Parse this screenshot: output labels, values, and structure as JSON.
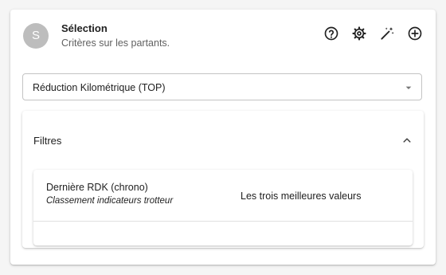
{
  "card": {
    "avatar_letter": "S",
    "title": "Sélection",
    "subtitle": "Critères sur les partants.",
    "actions": [
      {
        "icon": "help-circle-icon"
      },
      {
        "icon": "gear-icon"
      },
      {
        "icon": "magic-wand-icon"
      },
      {
        "icon": "add-circle-icon"
      }
    ]
  },
  "select": {
    "value": "Réduction Kilométrique (TOP)",
    "icon": "caret-down-icon"
  },
  "filters": {
    "title": "Filtres",
    "toggle_icon": "chevron-up-icon",
    "rows": [
      {
        "name": "Dernière RDK (chrono)",
        "description": "Classement indicateurs trotteur",
        "value": "Les trois meilleures valeurs"
      }
    ]
  },
  "colors": {
    "avatar_bg": "#bdbdbd",
    "text_primary": "#212121",
    "text_secondary": "#616161",
    "border": "#c4c4c4"
  }
}
